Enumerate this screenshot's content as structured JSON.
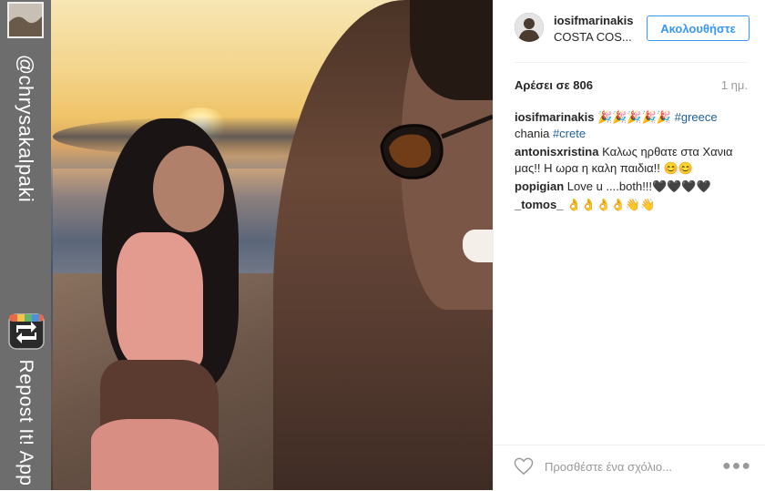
{
  "watermark": {
    "handle": "@chrysakalpaki",
    "app_name": "Repost It! App",
    "logo_icon": "repost-app-icon"
  },
  "post": {
    "username": "iosifmarinakis",
    "location": "COSTA COS...",
    "follow_label": "Ακολουθήστε",
    "likes": "Αρέσει σε 806",
    "time": "1 ημ.",
    "caption": {
      "user": "iosifmarinakis",
      "text": "🎉🎉🎉🎉🎉",
      "tags": [
        "#greece",
        "chania",
        "#crete"
      ]
    },
    "comments": [
      {
        "user": "antonisxristina",
        "text": "Καλως ηρθατε στα Χανια μας!! Η ωρα η καλη παιδια!! 😊😊"
      },
      {
        "user": "popigian",
        "text": "Love u ....both!!!🖤🖤🖤🖤"
      },
      {
        "user": "_tomos_",
        "text": "👌👌👌👌👋👋"
      }
    ],
    "comment_placeholder": "Προσθέστε ένα σχόλιο...",
    "more_icon": "more-options-icon",
    "like_icon": "heart-icon"
  },
  "colors": {
    "accent": "#3897f0",
    "hashtag": "#1b5f9d",
    "strip": "#6d6d6d"
  }
}
